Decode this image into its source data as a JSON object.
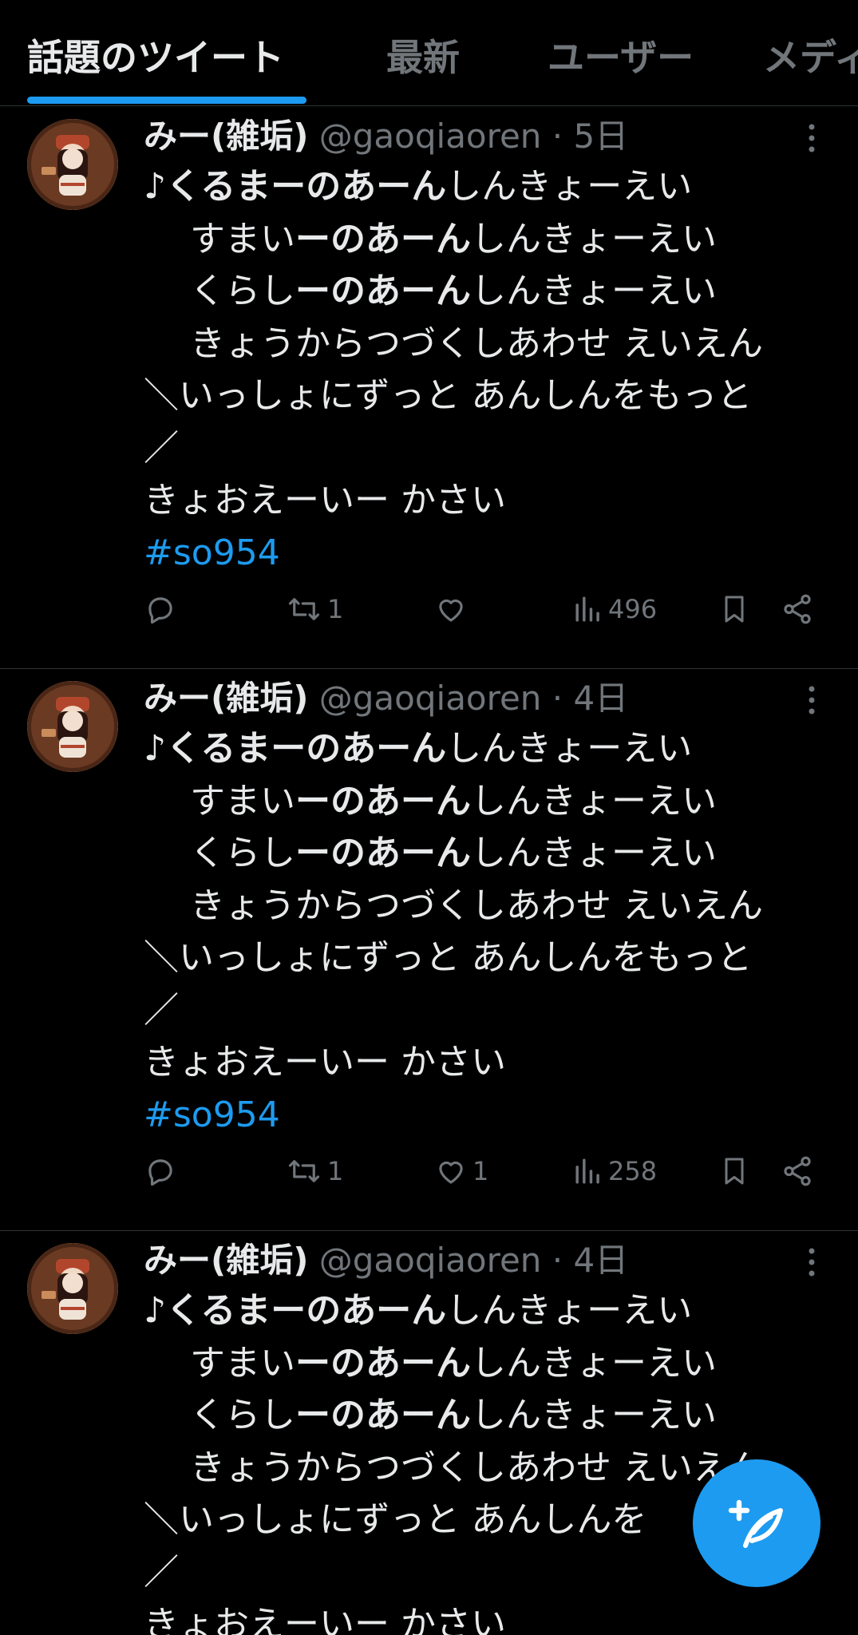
{
  "tabs": [
    {
      "label": "話題のツイート",
      "active": true
    },
    {
      "label": "最新",
      "active": false
    },
    {
      "label": "ユーザー",
      "active": false
    },
    {
      "label": "メディア",
      "active": false
    }
  ],
  "colors": {
    "accent": "#1d9bf0",
    "background": "#000000",
    "text": "#e7e9ea",
    "muted": "#71767b"
  },
  "tweets": [
    {
      "name": "みー(雑垢)",
      "handle": "@gaoqiaoren",
      "dot": "·",
      "time": "5日",
      "line1": {
        "bold": "♪くるまーのあーん",
        "rest": "しんきょーえい"
      },
      "line2": {
        "pre": "すまい",
        "bold": "ーのあーん",
        "rest": "しんきょーえい"
      },
      "line3": {
        "pre": "くらし",
        "bold": "ーのあーん",
        "rest": "しんきょーえい"
      },
      "line4": "きょうからつづくしあわせ えいえん",
      "line5": "＼いっしょにずっと あんしんをもっと",
      "line6": "／",
      "line7": "きょおえーいー かさい",
      "hashtag": "#so954",
      "retweets": "1",
      "likes": "",
      "views": "496"
    },
    {
      "name": "みー(雑垢)",
      "handle": "@gaoqiaoren",
      "dot": "·",
      "time": "4日",
      "line1": {
        "bold": "♪くるまーのあーん",
        "rest": "しんきょーえい"
      },
      "line2": {
        "pre": "すまい",
        "bold": "ーのあーん",
        "rest": "しんきょーえい"
      },
      "line3": {
        "pre": "くらし",
        "bold": "ーのあーん",
        "rest": "しんきょーえい"
      },
      "line4": "きょうからつづくしあわせ えいえん",
      "line5": "＼いっしょにずっと あんしんをもっと",
      "line6": "／",
      "line7": "きょおえーいー かさい",
      "hashtag": "#so954",
      "retweets": "1",
      "likes": "1",
      "views": "258"
    },
    {
      "name": "みー(雑垢)",
      "handle": "@gaoqiaoren",
      "dot": "·",
      "time": "4日",
      "line1": {
        "bold": "♪くるまーのあーん",
        "rest": "しんきょーえい"
      },
      "line2": {
        "pre": "すまい",
        "bold": "ーのあーん",
        "rest": "しんきょーえい"
      },
      "line3": {
        "pre": "くらし",
        "bold": "ーのあーん",
        "rest": "しんきょーえい"
      },
      "line4": "きょうからつづくしあわせ えいえん",
      "line5": "＼いっしょにずっと あんしんを",
      "line6": "／",
      "line7": "きょおえーいー かさい"
    }
  ]
}
